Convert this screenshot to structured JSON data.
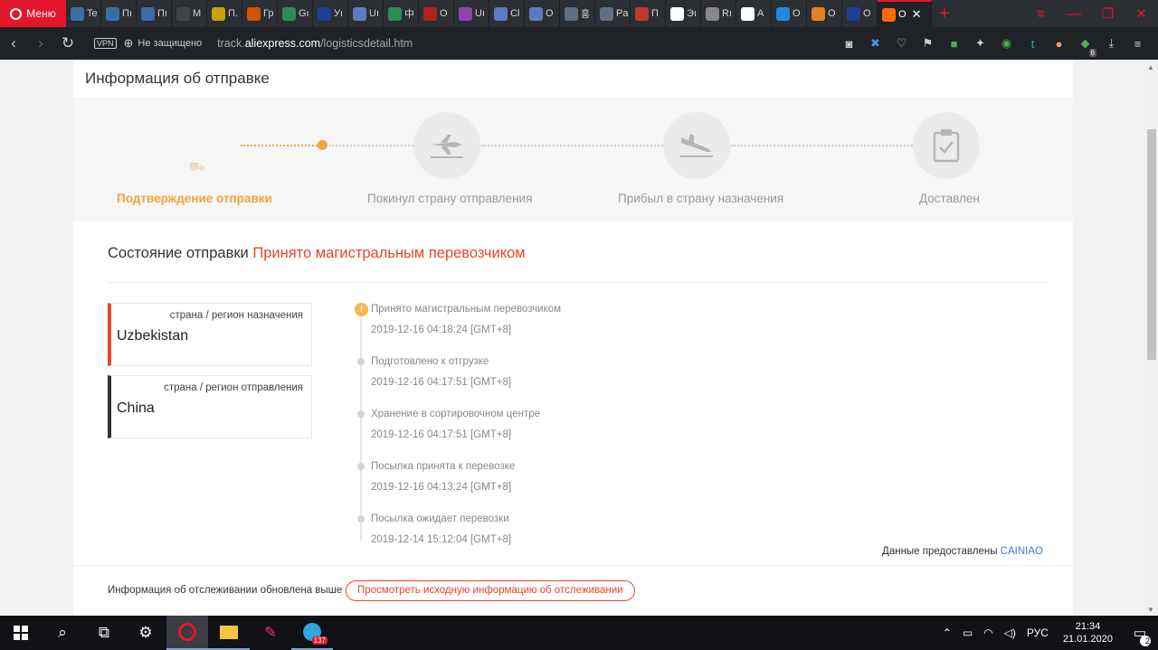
{
  "browser": {
    "menu_label": "Меню",
    "tabs": [
      {
        "label": "Te",
        "color": "#3b6ea5"
      },
      {
        "label": "Пı",
        "color": "#3b6ea5"
      },
      {
        "label": "Пı",
        "color": "#3b6ea5"
      },
      {
        "label": "M",
        "color": "#444444"
      },
      {
        "label": "П.",
        "color": "#c8a400"
      },
      {
        "label": "Гр",
        "color": "#d35400"
      },
      {
        "label": "Gı",
        "color": "#2e8b57"
      },
      {
        "label": "Уı",
        "color": "#1c3f94"
      },
      {
        "label": "Uı",
        "color": "#5a7dbf"
      },
      {
        "label": "中",
        "color": "#2e8b57"
      },
      {
        "label": "O",
        "color": "#b22222"
      },
      {
        "label": "Uı",
        "color": "#8e44ad"
      },
      {
        "label": "Cl",
        "color": "#5a7dbf"
      },
      {
        "label": "O",
        "color": "#5a7dbf"
      },
      {
        "label": "홍",
        "color": "#607080"
      },
      {
        "label": "Pa",
        "color": "#607080"
      },
      {
        "label": "П",
        "color": "#c0392b"
      },
      {
        "label": "Эı",
        "color": "#ffffff"
      },
      {
        "label": "Rı",
        "color": "#888888"
      },
      {
        "label": "A",
        "color": "#ffffff"
      },
      {
        "label": "O",
        "color": "#1e88e5"
      },
      {
        "label": "O",
        "color": "#e67e22"
      },
      {
        "label": "O",
        "color": "#1c3f94"
      }
    ],
    "active_tab": {
      "label": "O",
      "color": "#ff6a00"
    },
    "vpn_label": "VPN",
    "security_label": "Не защищено",
    "url_prefix": "track.",
    "url_host": "aliexpress.com",
    "url_path": "/logisticsdetail.htm",
    "extension_badge": "6"
  },
  "page": {
    "title": "Информация об отправке",
    "steps": [
      {
        "label": "Подтверждение отправки",
        "state": "active"
      },
      {
        "label": "Покинул страну отправления",
        "state": "pending"
      },
      {
        "label": "Прибыл в страну назначения",
        "state": "pending"
      },
      {
        "label": "Доставлен",
        "state": "pending"
      }
    ],
    "status_label": "Состояние отправки",
    "status_value": "Принято магистральным перевозчиком",
    "destination": {
      "label": "страна / регион назначения",
      "value": "Uzbekistan"
    },
    "origin": {
      "label": "страна / регион отправления",
      "value": "China"
    },
    "events": [
      {
        "text": "Принято магистральным перевозчиком",
        "time": "2019-12-16 04:18:24 [GMT+8]"
      },
      {
        "text": "Подготовлено к отгрузке",
        "time": "2019-12-16 04:17:51 [GMT+8]"
      },
      {
        "text": "Хранение в сортировочном центре",
        "time": "2019-12-16 04:17:51 [GMT+8]"
      },
      {
        "text": "Посылка принята к перевозке",
        "time": "2019-12-16 04:13:24 [GMT+8]"
      },
      {
        "text": "Посылка ожидает перевозки",
        "time": "2019-12-14 15:12:04 [GMT+8]"
      }
    ],
    "provided_by_label": "Данные предоставлены",
    "provided_by_value": "CAINIAO",
    "updated_note": "Информация об отслеживании обновлена выше",
    "original_info_button": "Просмотреть исходную информацию об отслеживании"
  },
  "taskbar": {
    "telegram_badge": "137",
    "language": "РУС",
    "time": "21:34",
    "date": "21.01.2020",
    "notifications": "2"
  },
  "colors": {
    "accent_orange": "#f6a23c",
    "status_red": "#e6452a",
    "link_blue": "#3d7bd8",
    "opera_red": "#e3172b"
  }
}
